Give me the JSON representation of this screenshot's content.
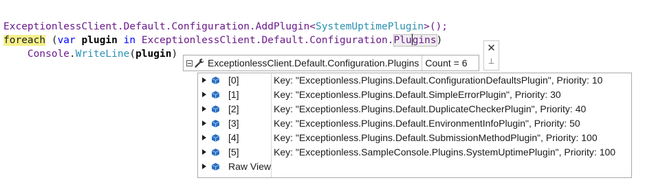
{
  "code": {
    "line1": {
      "t1": "ExceptionlessClient",
      "t2": ".Default.Configuration.AddPlugin<",
      "t3": "SystemUptimePlugin",
      "t4": ">();"
    },
    "line2": {
      "kw_foreach": "foreach",
      "t1": " (",
      "kw_var": "var",
      "t2": " ",
      "plugin": "plugin",
      "t3": " ",
      "kw_in": "in",
      "t4": " ",
      "cls": "ExceptionlessClient",
      "t5": ".Default.Configuration.",
      "prop_a": "Plu",
      "prop_b": "gins",
      "t6": ")"
    },
    "line3": {
      "indent": "    ",
      "console": "Console",
      "dot": ".",
      "method": "WriteLine",
      "open": "(",
      "arg": "plugin",
      "close": ")"
    }
  },
  "datatip": {
    "expression": "ExceptionlessClient.Default.Configuration.Plugins",
    "count": "Count = 6",
    "close_glyph": "✕",
    "pin_glyph": "⊥",
    "items": [
      {
        "name": "[0]",
        "value": "Key: \"Exceptionless.Plugins.Default.ConfigurationDefaultsPlugin\", Priority: 10"
      },
      {
        "name": "[1]",
        "value": "Key: \"Exceptionless.Plugins.Default.SimpleErrorPlugin\", Priority: 30"
      },
      {
        "name": "[2]",
        "value": "Key: \"Exceptionless.Plugins.Default.DuplicateCheckerPlugin\", Priority: 40"
      },
      {
        "name": "[3]",
        "value": "Key: \"Exceptionless.Plugins.Default.EnvironmentInfoPlugin\", Priority: 50"
      },
      {
        "name": "[4]",
        "value": "Key: \"Exceptionless.Plugins.Default.SubmissionMethodPlugin\", Priority: 100"
      },
      {
        "name": "[5]",
        "value": "Key: \"Exceptionless.SampleConsole.Plugins.SystemUptimePlugin\", Priority: 100"
      },
      {
        "name": "Raw View",
        "value": ""
      }
    ]
  },
  "colors": {
    "keyword": "#0000ff",
    "type": "#2b91af",
    "highlight": "#f5f08a",
    "object_icon": "#2a6fc0"
  },
  "icons": {
    "expand": "triangle-right-icon",
    "object": "object-cube-icon",
    "wrench": "wrench-icon",
    "collapse": "collapse-box-icon"
  }
}
